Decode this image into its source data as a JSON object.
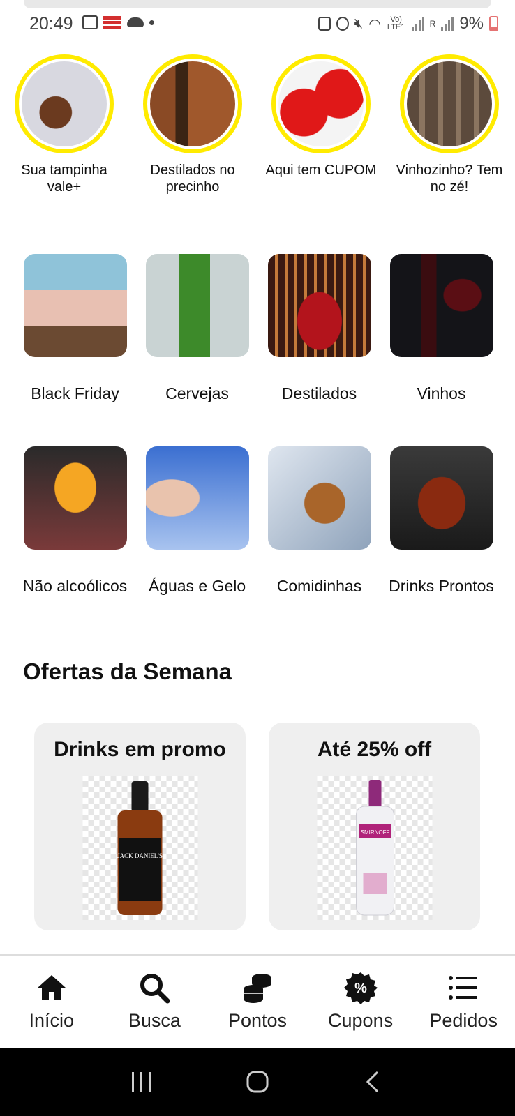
{
  "status_bar": {
    "time": "20:49",
    "battery": "9%",
    "network_label": "Vo) LTE1",
    "sim2_label": "R"
  },
  "stories": [
    {
      "label": "Sua tampinha vale+",
      "image": "beer-bottle-opening"
    },
    {
      "label": "Destilados no precinho",
      "image": "whisky-bottle-and-glass"
    },
    {
      "label": "Aqui tem CUPOM",
      "image": "red-percent-balloons"
    },
    {
      "label": "Vinhozinho? Tem no zé!",
      "image": "wine-barrels"
    }
  ],
  "categories": [
    {
      "label": "Black Friday",
      "image": "beer-glasses"
    },
    {
      "label": "Cervejas",
      "image": "green-beer-bottle"
    },
    {
      "label": "Destilados",
      "image": "gentleman-jack-bottle"
    },
    {
      "label": "Vinhos",
      "image": "red-wine-pouring"
    },
    {
      "label": "Não alcoólicos",
      "image": "orange-drink"
    },
    {
      "label": "Águas e Gelo",
      "image": "drinking-water"
    },
    {
      "label": "Comidinhas",
      "image": "pretzels"
    },
    {
      "label": "Drinks Prontos",
      "image": "negroni-glass"
    }
  ],
  "offers": {
    "title": "Ofertas da Semana",
    "items": [
      {
        "title": "Drinks em promo",
        "product_label": "JACK DANIEL'S",
        "product_image": "jack-daniels-bottle"
      },
      {
        "title": "Até 25% off",
        "product_label": "SMIRNOFF",
        "product_image": "smirnoff-raspberry-bottle"
      }
    ]
  },
  "bottom_nav": [
    {
      "label": "Início",
      "icon": "home-icon"
    },
    {
      "label": "Busca",
      "icon": "search-icon"
    },
    {
      "label": "Pontos",
      "icon": "coins-icon"
    },
    {
      "label": "Cupons",
      "icon": "coupon-percent-icon"
    },
    {
      "label": "Pedidos",
      "icon": "list-icon"
    }
  ],
  "colors": {
    "story_ring": "#ffeb00",
    "offer_card_bg": "#efefef",
    "nav_icon": "#111111"
  }
}
